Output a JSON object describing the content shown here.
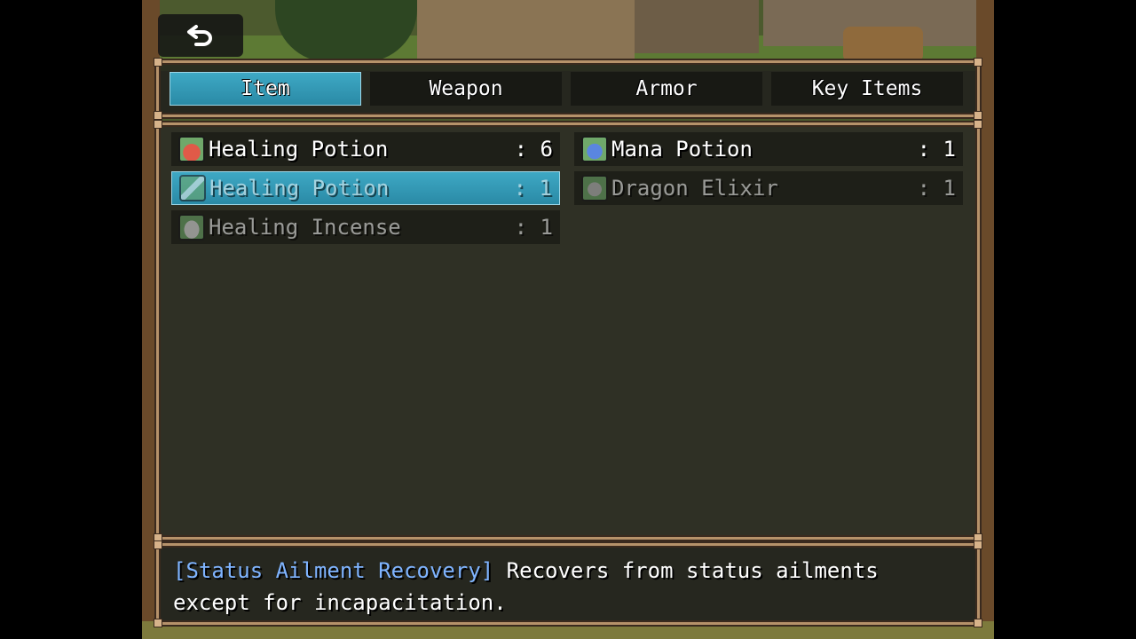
{
  "back_button": {
    "icon": "back-arrow-icon"
  },
  "tabs": [
    {
      "label": "Item",
      "selected": true
    },
    {
      "label": "Weapon",
      "selected": false
    },
    {
      "label": "Armor",
      "selected": false
    },
    {
      "label": "Key Items",
      "selected": false
    }
  ],
  "items": [
    {
      "name": "Healing Potion",
      "count": ": 6",
      "icon": "red-potion-icon",
      "icon_color": "#d94a3a",
      "enabled": true,
      "selected": false
    },
    {
      "name": "Mana Potion",
      "count": ": 1",
      "icon": "blue-potion-icon",
      "icon_color": "#3a6ed9",
      "enabled": true,
      "selected": false
    },
    {
      "name": "Healing Potion",
      "count": ": 1",
      "icon": "syringe-icon",
      "icon_color": "#cfd8d0",
      "enabled": false,
      "selected": true
    },
    {
      "name": "Dragon Elixir",
      "count": ": 1",
      "icon": "urn-icon",
      "icon_color": "#9a9a9a",
      "enabled": false,
      "selected": false
    },
    {
      "name": "Healing Incense",
      "count": ": 1",
      "icon": "pouch-icon",
      "icon_color": "#d8d8d8",
      "enabled": false,
      "selected": false
    }
  ],
  "help": {
    "tag": "[Status Ailment Recovery]",
    "line1": " Recovers from status ailments",
    "line2": "except for incapacitation."
  },
  "colors": {
    "selection": "#3ea8c4",
    "frame": "#b6926a",
    "help_tag": "#7fb4ff"
  }
}
